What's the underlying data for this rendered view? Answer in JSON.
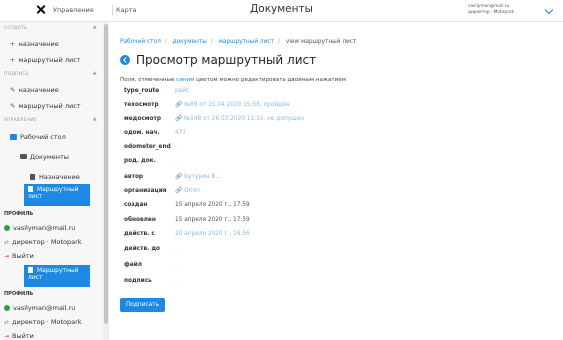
{
  "topbar": {
    "manage_label": "Управление",
    "map_label": "Карта",
    "title": "Документы",
    "user_email": "vasilyman@mail.ru",
    "user_role": "директор · Motopark"
  },
  "sidebar": {
    "section_create": "Создать",
    "create_items": [
      "назначение",
      "маршрутный лист"
    ],
    "section_sign": "Подпись",
    "sign_items": [
      "назначение",
      "маршрутный лист"
    ],
    "section_manage": "Управление",
    "desk": "Рабочий стол",
    "documents": "Документы",
    "assignment": "Назначение",
    "route_list": "Маршрутный лист",
    "profile_head": "Профиль",
    "email": "vasilyman@mail.ru",
    "role": "директор · Motopark",
    "logout": "Выйти",
    "route_list2": "Маршрутный лист",
    "profile_head2": "Профиль",
    "email2": "vasilyman@mail.ru",
    "role2": "директор · Motopark",
    "logout2": "Выйти"
  },
  "breadcrumb": [
    "Рабочий стол",
    "документы",
    "маршрутный лист",
    "view маршрутный лист"
  ],
  "page_title": "Просмотр маршрутный лист",
  "hint": {
    "before": "Поля, отмеченные ",
    "blue": "синим",
    "after": " цветом можно редактировать двойным нажатием"
  },
  "fields": [
    {
      "label": "type_route",
      "value": "рейс"
    },
    {
      "label": "техосмотр",
      "value": "№89 от 15.04.2020 15:56, пройден"
    },
    {
      "label": "медосмотр",
      "value": "№148 от 26.03.2020 11:15, не допущен"
    },
    {
      "label": "одом. нач.",
      "value": "477"
    },
    {
      "label": "odometer_end",
      "value": "-"
    },
    {
      "label": "род. док.",
      "value": "-"
    },
    {
      "label": "автор",
      "value": "Бутурин В..."
    },
    {
      "label": "организация",
      "value": "Orion"
    },
    {
      "label": "создан",
      "value": "15 апреля 2020 г., 17:59"
    },
    {
      "label": "обновлен",
      "value": "15 апреля 2020 г., 17:59"
    },
    {
      "label": "действ. с",
      "value": "20 апреля 2020 г., 16:56"
    },
    {
      "label": "действ. до",
      "value": "-"
    },
    {
      "label": "файл",
      "value": "-"
    },
    {
      "label": "подпись",
      "value": "-"
    }
  ],
  "sign_button": "Подписать"
}
